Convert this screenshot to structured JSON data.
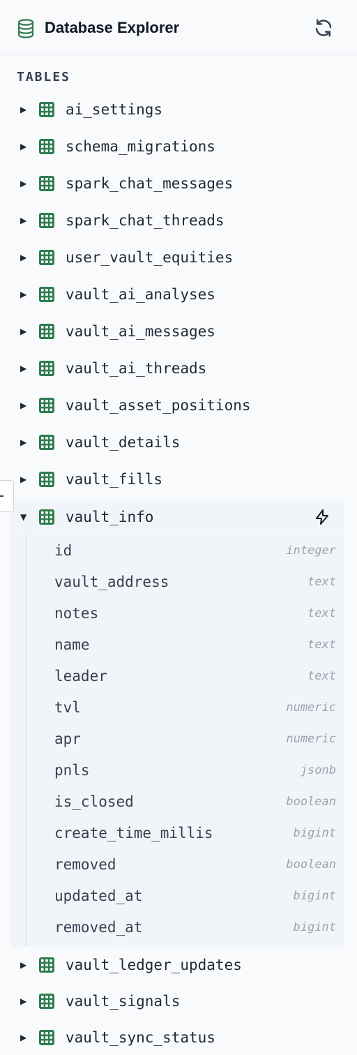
{
  "header": {
    "title": "Database Explorer",
    "db_icon": "database-icon",
    "refresh_icon": "refresh-icon"
  },
  "sidebar": {
    "section_title": "TABLES",
    "collapsed_chevron": "▶",
    "expanded_chevron": "▼",
    "table_icon": "table-grid-icon",
    "accent_color": "#2f7d4f"
  },
  "tables_before": [
    {
      "name": "ai_settings"
    },
    {
      "name": "schema_migrations"
    },
    {
      "name": "spark_chat_messages"
    },
    {
      "name": "spark_chat_threads"
    },
    {
      "name": "user_vault_equities"
    },
    {
      "name": "vault_ai_analyses"
    },
    {
      "name": "vault_ai_messages"
    },
    {
      "name": "vault_ai_threads"
    },
    {
      "name": "vault_asset_positions"
    },
    {
      "name": "vault_details"
    },
    {
      "name": "vault_fills"
    }
  ],
  "expanded_table": {
    "name": "vault_info",
    "action_icon": "lightning-bolt-icon",
    "columns": [
      {
        "name": "id",
        "type": "integer"
      },
      {
        "name": "vault_address",
        "type": "text"
      },
      {
        "name": "notes",
        "type": "text"
      },
      {
        "name": "name",
        "type": "text"
      },
      {
        "name": "leader",
        "type": "text"
      },
      {
        "name": "tvl",
        "type": "numeric"
      },
      {
        "name": "apr",
        "type": "numeric"
      },
      {
        "name": "pnls",
        "type": "jsonb"
      },
      {
        "name": "is_closed",
        "type": "boolean"
      },
      {
        "name": "create_time_millis",
        "type": "bigint"
      },
      {
        "name": "removed",
        "type": "boolean"
      },
      {
        "name": "updated_at",
        "type": "bigint"
      },
      {
        "name": "removed_at",
        "type": "bigint"
      }
    ]
  },
  "tables_after": [
    {
      "name": "vault_ledger_updates"
    },
    {
      "name": "vault_signals"
    },
    {
      "name": "vault_sync_status"
    }
  ]
}
